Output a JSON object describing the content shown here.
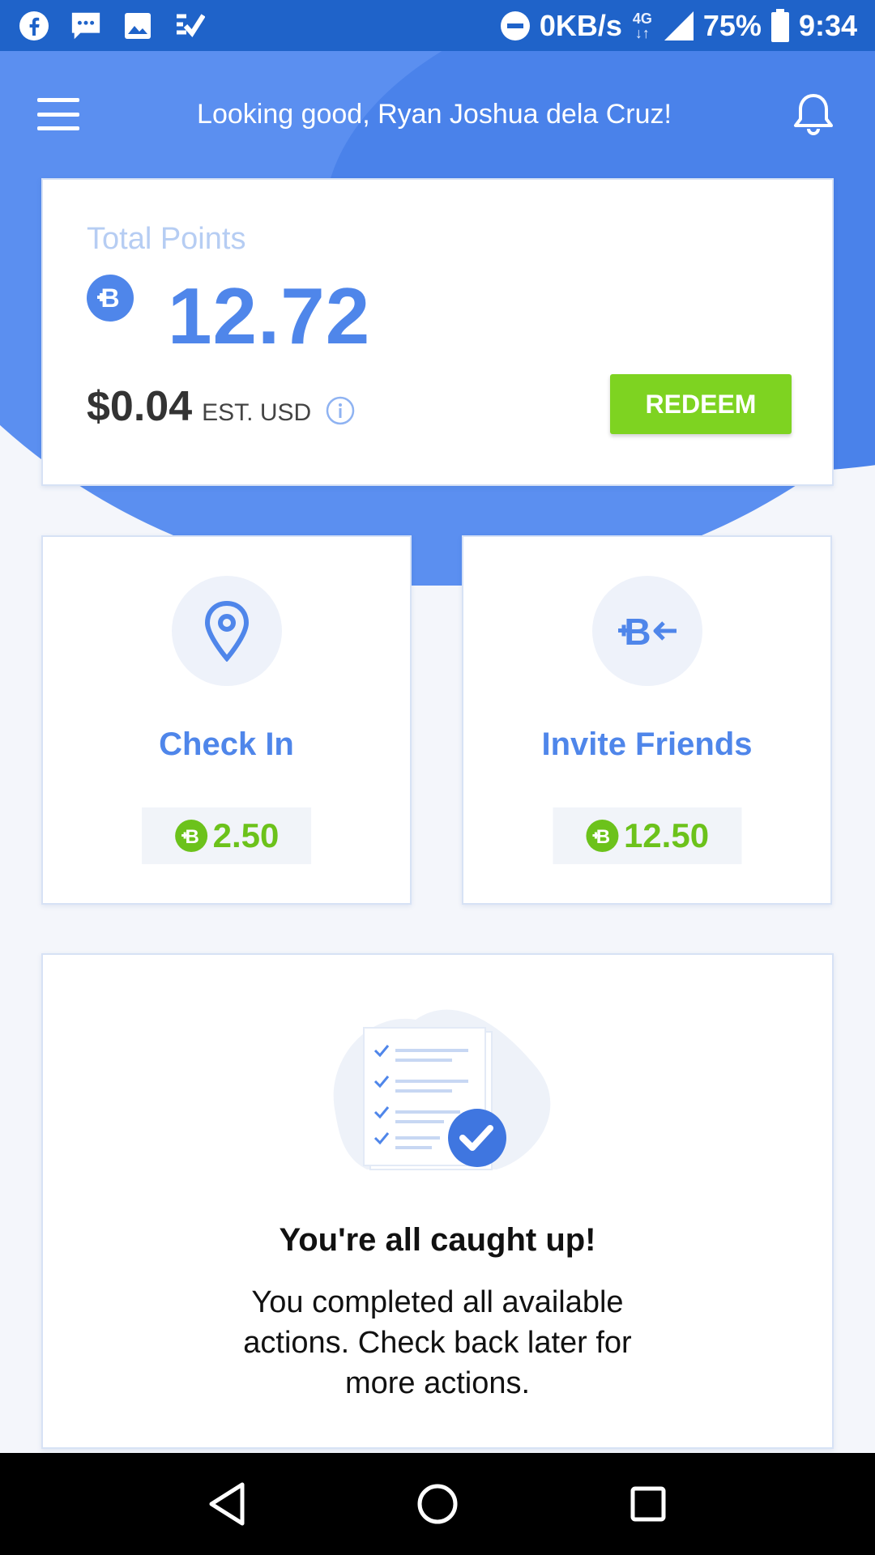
{
  "status_bar": {
    "speed": "0KB/s",
    "network": "4G",
    "battery": "75%",
    "time": "9:34"
  },
  "header": {
    "title": "Looking good, Ryan Joshua dela Cruz!"
  },
  "points": {
    "label": "Total Points",
    "value": "12.72",
    "usd_value": "$0.04",
    "usd_label": "EST. USD",
    "redeem_label": "REDEEM"
  },
  "actions": [
    {
      "title": "Check In",
      "reward": "2.50",
      "icon": "location-pin-icon"
    },
    {
      "title": "Invite Friends",
      "reward": "12.50",
      "icon": "invite-coin-arrow-icon"
    }
  ],
  "caught_up": {
    "title": "You're all caught up!",
    "message": "You completed all available actions. Check back later for more actions."
  },
  "colors": {
    "brand_blue": "#4f86ea",
    "status_blue": "#1f63c9",
    "redeem_green": "#7ed321",
    "reward_green": "#6cc21b"
  }
}
